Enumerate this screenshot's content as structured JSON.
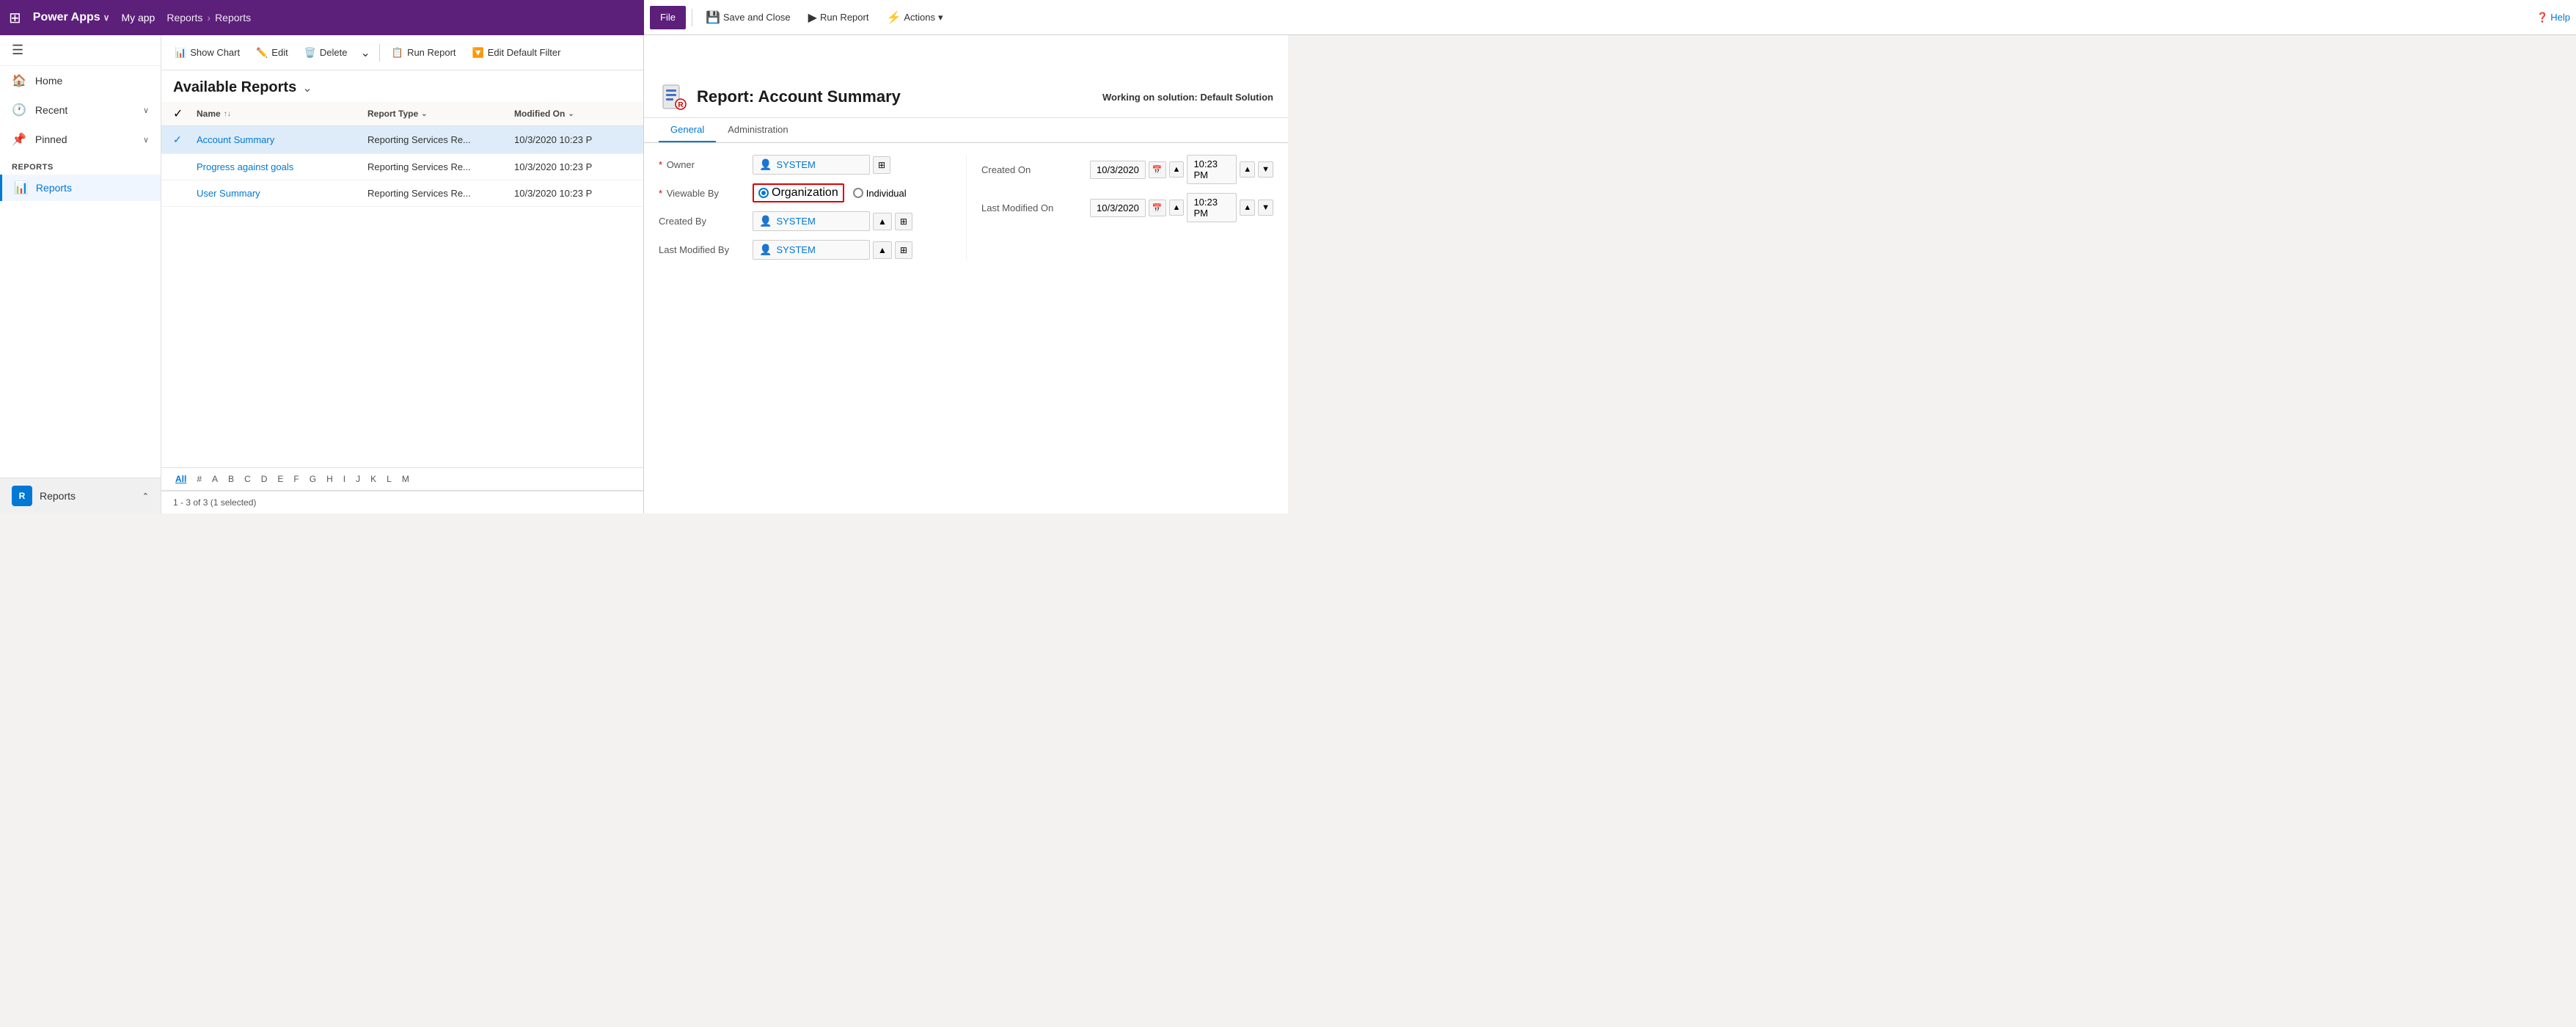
{
  "app": {
    "name": "Power Apps",
    "my_app": "My app",
    "breadcrumb1": "Reports",
    "breadcrumb2": "Reports",
    "waffle_icon": "⊞"
  },
  "ribbon": {
    "file_label": "File",
    "save_close_label": "Save and Close",
    "run_report_label": "Run Report",
    "actions_label": "Actions",
    "help_label": "Help",
    "save_icon": "💾",
    "run_icon": "▶",
    "actions_icon": "⚡"
  },
  "sidebar": {
    "toggle_icon": "☰",
    "home_label": "Home",
    "recent_label": "Recent",
    "pinned_label": "Pinned",
    "section_label": "Reports",
    "reports_label": "Reports",
    "bottom_label": "Reports",
    "avatar_text": "R"
  },
  "list": {
    "toolbar": {
      "show_chart_label": "Show Chart",
      "edit_label": "Edit",
      "delete_label": "Delete",
      "run_report_label": "Run Report",
      "edit_filter_label": "Edit Default Filter",
      "more_icon": "⌄"
    },
    "title": "Available Reports",
    "columns": {
      "name": "Name",
      "report_type": "Report Type",
      "modified_on": "Modified On"
    },
    "rows": [
      {
        "name": "Account Summary",
        "report_type": "Reporting Services Re...",
        "modified_on": "10/3/2020 10:23 P",
        "selected": true
      },
      {
        "name": "Progress against goals",
        "report_type": "Reporting Services Re...",
        "modified_on": "10/3/2020 10:23 P",
        "selected": false
      },
      {
        "name": "User Summary",
        "report_type": "Reporting Services Re...",
        "modified_on": "10/3/2020 10:23 P",
        "selected": false
      }
    ],
    "alpha": [
      "All",
      "#",
      "A",
      "B",
      "C",
      "D",
      "E",
      "F",
      "G",
      "H",
      "I",
      "J",
      "K",
      "L",
      "M"
    ],
    "pagination": "1 - 3 of 3 (1 selected)"
  },
  "detail": {
    "title": "Report: Account Summary",
    "solution": "Working on solution: Default Solution",
    "tabs": [
      "General",
      "Administration"
    ],
    "active_tab": "General",
    "fields": {
      "owner_label": "Owner",
      "owner_value": "SYSTEM",
      "viewable_by_label": "Viewable By",
      "viewable_org": "Organization",
      "viewable_ind": "Individual",
      "created_by_label": "Created By",
      "created_by_value": "SYSTEM",
      "last_modified_by_label": "Last Modified By",
      "last_modified_by_value": "SYSTEM",
      "created_on_label": "Created On",
      "created_on_date": "10/3/2020",
      "created_on_time": "10:23 PM",
      "last_modified_on_label": "Last Modified On",
      "last_modified_on_date": "10/3/2020",
      "last_modified_on_time": "10:23 PM"
    }
  }
}
